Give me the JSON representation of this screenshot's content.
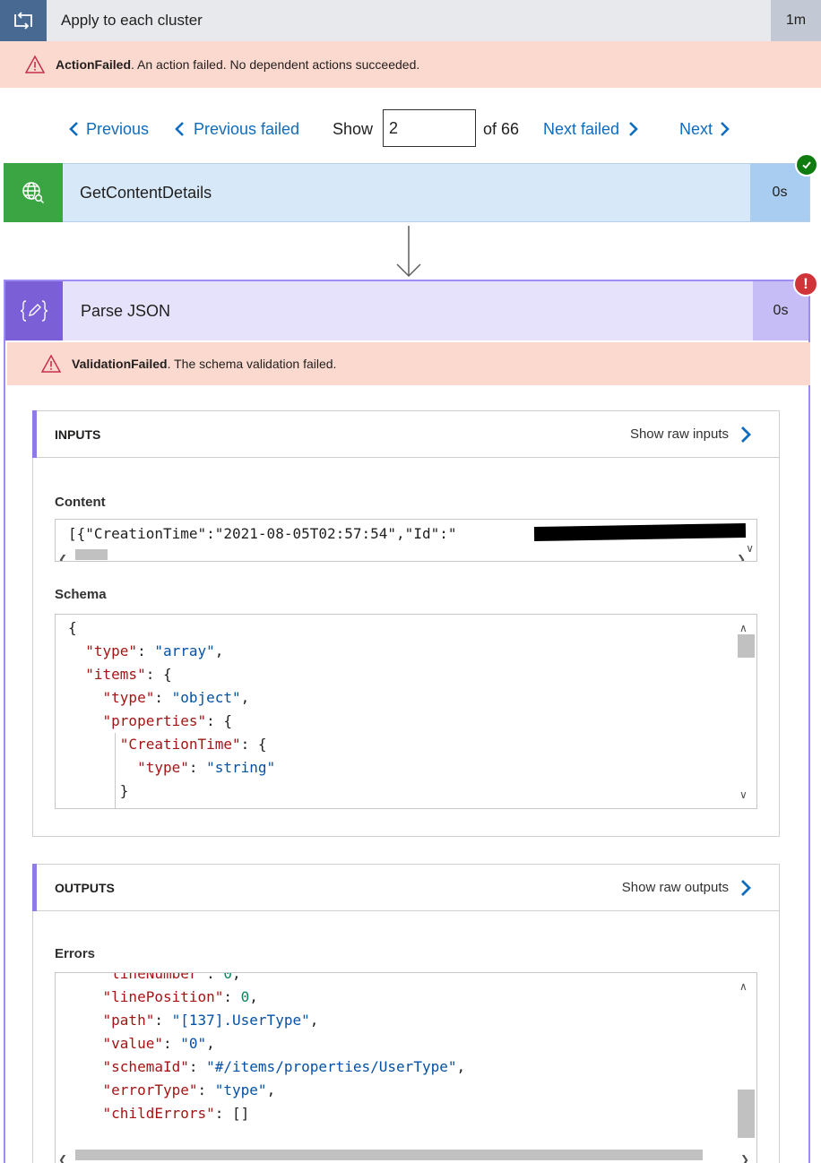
{
  "loop": {
    "title": "Apply to each cluster",
    "duration": "1m",
    "icon": "loop-icon"
  },
  "loop_banner": {
    "code": "ActionFailed",
    "message": ". An action failed. No dependent actions succeeded."
  },
  "pager": {
    "previous": "Previous",
    "previous_failed": "Previous failed",
    "show": "Show",
    "current": "2",
    "of": "of 66",
    "next_failed": "Next failed",
    "next": "Next"
  },
  "http_action": {
    "title": "GetContentDetails",
    "duration": "0s",
    "status": "succeeded",
    "icon": "globe-search-icon"
  },
  "parse_action": {
    "title": "Parse JSON",
    "duration": "0s",
    "status": "failed",
    "icon": "curly-braces-pencil-icon"
  },
  "parse_banner": {
    "code": "ValidationFailed",
    "message": ". The schema validation failed."
  },
  "inputs": {
    "header": "INPUTS",
    "show_raw": "Show raw inputs",
    "content_label": "Content",
    "content_text": "[{\"CreationTime\":\"2021-08-05T02:57:54\",\"Id\":\"",
    "schema_label": "Schema"
  },
  "outputs": {
    "header": "OUTPUTS",
    "show_raw": "Show raw outputs",
    "errors_label": "Errors"
  },
  "colors": {
    "loop_icon_bg": "#486991",
    "http_icon_bg": "#3aa542",
    "parse_icon_bg": "#7b5fd6",
    "error_banner": "#fcd9ce",
    "link": "#0f6cbd"
  }
}
